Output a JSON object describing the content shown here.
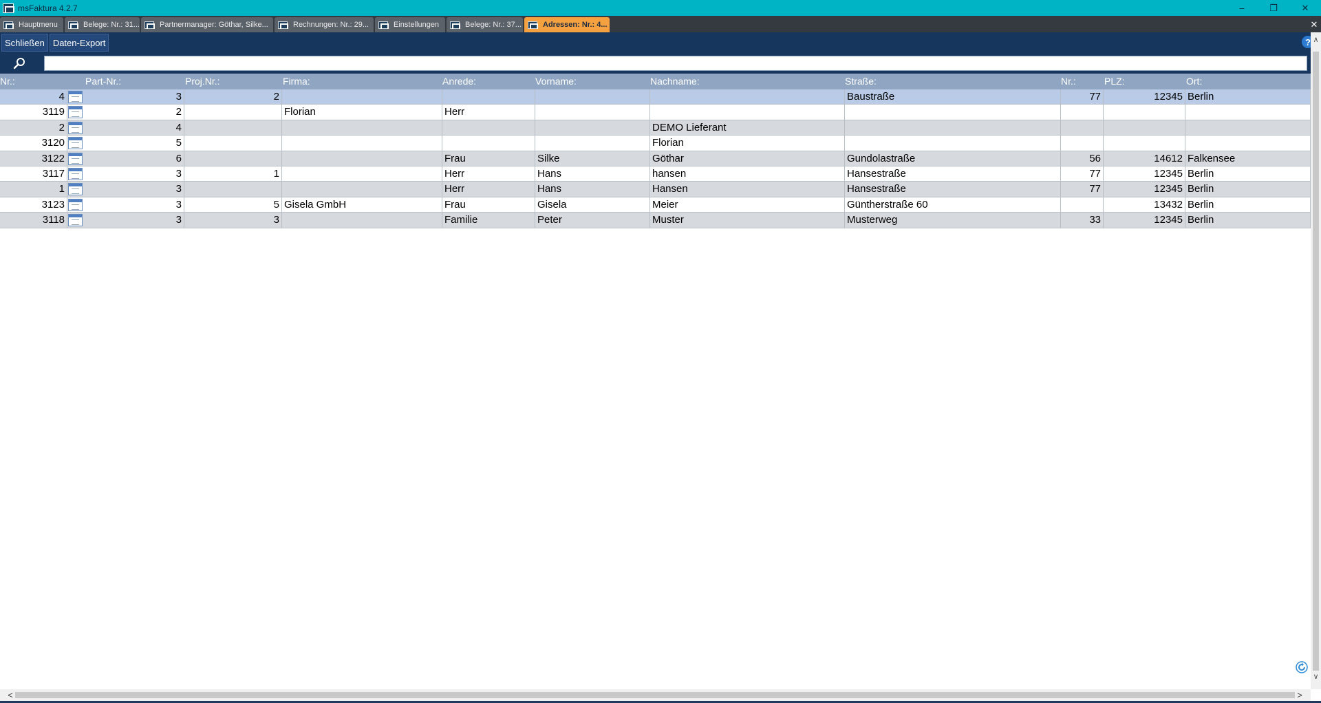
{
  "window": {
    "title": "msFaktura 4.2.7",
    "minimize": "–",
    "maximize": "❐",
    "close": "✕"
  },
  "tabs": [
    {
      "label": "Hauptmenu",
      "width": 92,
      "active": false
    },
    {
      "label": "Belege: Nr.: 31...",
      "width": 109,
      "active": false
    },
    {
      "label": "Partnermanager: Göthar, Silke...",
      "width": 192,
      "active": false
    },
    {
      "label": "Rechnungen: Nr.: 29...",
      "width": 144,
      "active": false
    },
    {
      "label": "Einstellungen",
      "width": 102,
      "active": false
    },
    {
      "label": "Belege: Nr.: 37...",
      "width": 111,
      "active": false
    },
    {
      "label": "Adressen: Nr.: 4...",
      "width": 124,
      "active": true
    }
  ],
  "tabstrip_close": "✕",
  "toolbar": {
    "close_label": "Schließen",
    "export_label": "Daten-Export",
    "help": "?"
  },
  "search": {
    "value": "",
    "placeholder": ""
  },
  "table": {
    "headers": [
      "Nr.:",
      "Part-Nr.:",
      "Proj.Nr.:",
      "Firma:",
      "Anrede:",
      "Vorname:",
      "Nachname:",
      "Straße:",
      "Nr.:",
      "PLZ:",
      "Ort:"
    ],
    "rows": [
      {
        "nr": "4",
        "part": "3",
        "proj": "2",
        "firma": "",
        "anrede": "",
        "vorname": "",
        "nachname": "",
        "strasse": "Baustraße",
        "hnr": "77",
        "plz": "12345",
        "ort": "Berlin",
        "style": "sel"
      },
      {
        "nr": "3119",
        "part": "2",
        "proj": "",
        "firma": "Florian",
        "anrede": "Herr",
        "vorname": "",
        "nachname": "",
        "strasse": "",
        "hnr": "",
        "plz": "",
        "ort": "",
        "style": "white"
      },
      {
        "nr": "2",
        "part": "4",
        "proj": "",
        "firma": "",
        "anrede": "",
        "vorname": "",
        "nachname": "DEMO Lieferant",
        "strasse": "",
        "hnr": "",
        "plz": "",
        "ort": "",
        "style": "alt"
      },
      {
        "nr": "3120",
        "part": "5",
        "proj": "",
        "firma": "",
        "anrede": "",
        "vorname": "",
        "nachname": "Florian",
        "strasse": "",
        "hnr": "",
        "plz": "",
        "ort": "",
        "style": "white"
      },
      {
        "nr": "3122",
        "part": "6",
        "proj": "",
        "firma": "",
        "anrede": "Frau",
        "vorname": "Silke",
        "nachname": "Göthar",
        "strasse": "Gundolastraße",
        "hnr": "56",
        "plz": "14612",
        "ort": "Falkensee",
        "style": "alt"
      },
      {
        "nr": "3117",
        "part": "3",
        "proj": "1",
        "firma": "",
        "anrede": "Herr",
        "vorname": "Hans",
        "nachname": "hansen",
        "strasse": "Hansestraße",
        "hnr": "77",
        "plz": "12345",
        "ort": "Berlin",
        "style": "white"
      },
      {
        "nr": "1",
        "part": "3",
        "proj": "",
        "firma": "",
        "anrede": "Herr",
        "vorname": "Hans",
        "nachname": "Hansen",
        "strasse": "Hansestraße",
        "hnr": "77",
        "plz": "12345",
        "ort": "Berlin",
        "style": "alt"
      },
      {
        "nr": "3123",
        "part": "3",
        "proj": "5",
        "firma": "Gisela GmbH",
        "anrede": "Frau",
        "vorname": "Gisela",
        "nachname": "Meier",
        "strasse": "Güntherstraße 60",
        "hnr": "",
        "plz": "13432",
        "ort": "Berlin",
        "style": "white"
      },
      {
        "nr": "3118",
        "part": "3",
        "proj": "3",
        "firma": "",
        "anrede": "Familie",
        "vorname": "Peter",
        "nachname": "Muster",
        "strasse": "Musterweg",
        "hnr": "33",
        "plz": "12345",
        "ort": "Berlin",
        "style": "alt"
      }
    ]
  },
  "colors": {
    "titlebar": "#00b4c6",
    "toolbar": "#17365d",
    "active_tab": "#f5a13f",
    "header": "#8fa5c1",
    "selected_row": "#b9cbe6"
  },
  "icons": [
    "app-logo-icon",
    "search-icon",
    "help-icon",
    "document-icon",
    "refresh-icon"
  ]
}
